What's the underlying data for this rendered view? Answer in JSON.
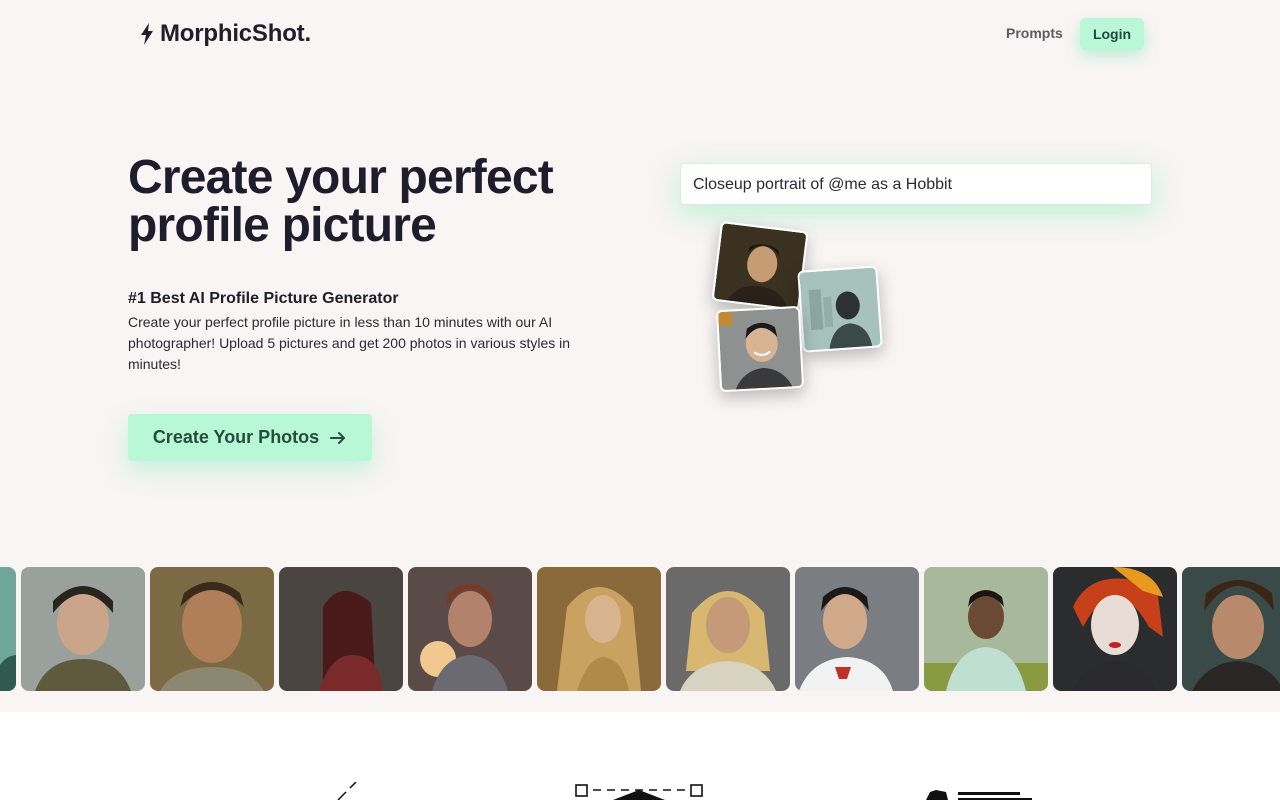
{
  "header": {
    "logo_text": "MorphicShot.",
    "nav_prompts": "Prompts",
    "nav_login": "Login"
  },
  "hero": {
    "title_line1": "Create your perfect",
    "title_line2": "profile picture",
    "subtitle": "#1 Best AI Profile Picture Generator",
    "description": "Create your perfect profile picture in less than 10 minutes with our AI photographer! Upload 5 pictures and get 200 photos in various styles in minutes!",
    "cta_label": "Create Your Photos"
  },
  "prompt_demo": {
    "value": "Closeup portrait of @me as a Hobbit"
  },
  "colors": {
    "accent": "#b8f8d7",
    "accent_text": "#244d3e",
    "background": "#f8f5f4",
    "heading": "#1d1d2b"
  },
  "icons": [
    "lightning-bolt-icon",
    "arrow-right-icon"
  ]
}
